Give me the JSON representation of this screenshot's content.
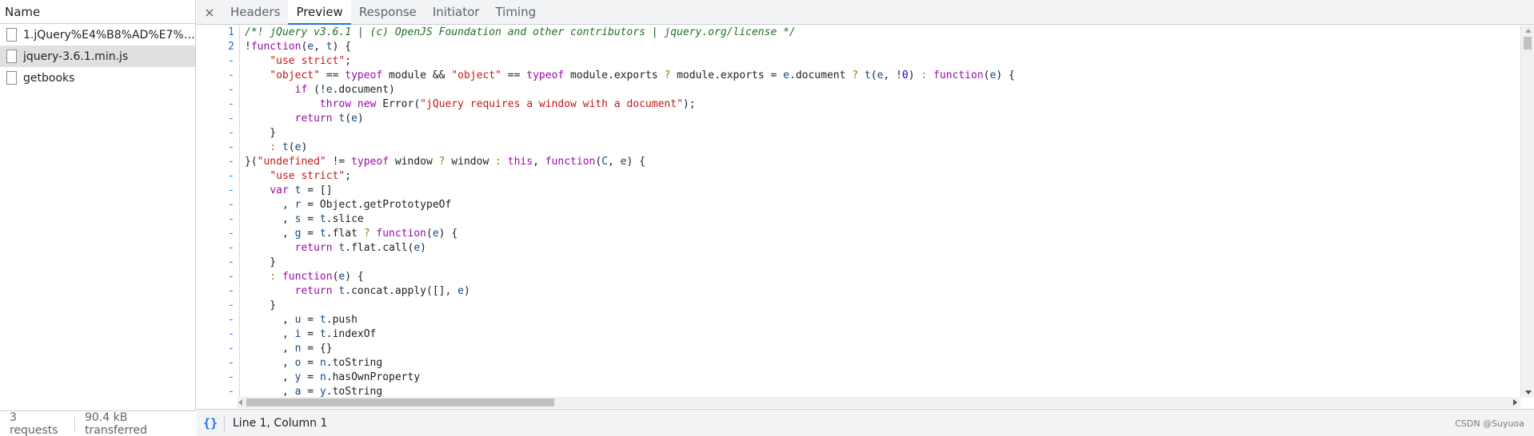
{
  "left_panel": {
    "header": "Name",
    "requests": [
      {
        "name": "1.jQuery%E4%B8%AD%E7%9..."
      },
      {
        "name": "jquery-3.6.1.min.js"
      },
      {
        "name": "getbooks"
      }
    ],
    "footer": {
      "requests": "3 requests",
      "transferred": "90.4 kB transferred"
    }
  },
  "tabs": {
    "close": "×",
    "items": [
      "Headers",
      "Preview",
      "Response",
      "Initiator",
      "Timing"
    ],
    "active": "Preview"
  },
  "status": {
    "format_icon": "{}",
    "cursor": "Line 1, Column 1",
    "watermark": "CSDN @Suyuoa"
  },
  "code_lines": [
    {
      "ln": "1",
      "code": "/*! jQuery v3.6.1 | (c) OpenJS Foundation and other contributors | jquery.org/license */"
    },
    {
      "ln": "2",
      "code": "!function(e, t) {"
    },
    {
      "ln": "-",
      "code": "    \"use strict\";"
    },
    {
      "ln": "-",
      "code": "    \"object\" == typeof module && \"object\" == typeof module.exports ? module.exports = e.document ? t(e, !0) : function(e) {"
    },
    {
      "ln": "-",
      "code": "        if (!e.document)"
    },
    {
      "ln": "-",
      "code": "            throw new Error(\"jQuery requires a window with a document\");"
    },
    {
      "ln": "-",
      "code": "        return t(e)"
    },
    {
      "ln": "-",
      "code": "    }"
    },
    {
      "ln": "-",
      "code": "    : t(e)"
    },
    {
      "ln": "-",
      "code": "}(\"undefined\" != typeof window ? window : this, function(C, e) {"
    },
    {
      "ln": "-",
      "code": "    \"use strict\";"
    },
    {
      "ln": "-",
      "code": "    var t = []"
    },
    {
      "ln": "-",
      "code": "      , r = Object.getPrototypeOf"
    },
    {
      "ln": "-",
      "code": "      , s = t.slice"
    },
    {
      "ln": "-",
      "code": "      , g = t.flat ? function(e) {"
    },
    {
      "ln": "-",
      "code": "        return t.flat.call(e)"
    },
    {
      "ln": "-",
      "code": "    }"
    },
    {
      "ln": "-",
      "code": "    : function(e) {"
    },
    {
      "ln": "-",
      "code": "        return t.concat.apply([], e)"
    },
    {
      "ln": "-",
      "code": "    }"
    },
    {
      "ln": "-",
      "code": "      , u = t.push"
    },
    {
      "ln": "-",
      "code": "      , i = t.indexOf"
    },
    {
      "ln": "-",
      "code": "      , n = {}"
    },
    {
      "ln": "-",
      "code": "      , o = n.toString"
    },
    {
      "ln": "-",
      "code": "      , y = n.hasOwnProperty"
    },
    {
      "ln": "-",
      "code": "      , a = y.toString"
    }
  ]
}
